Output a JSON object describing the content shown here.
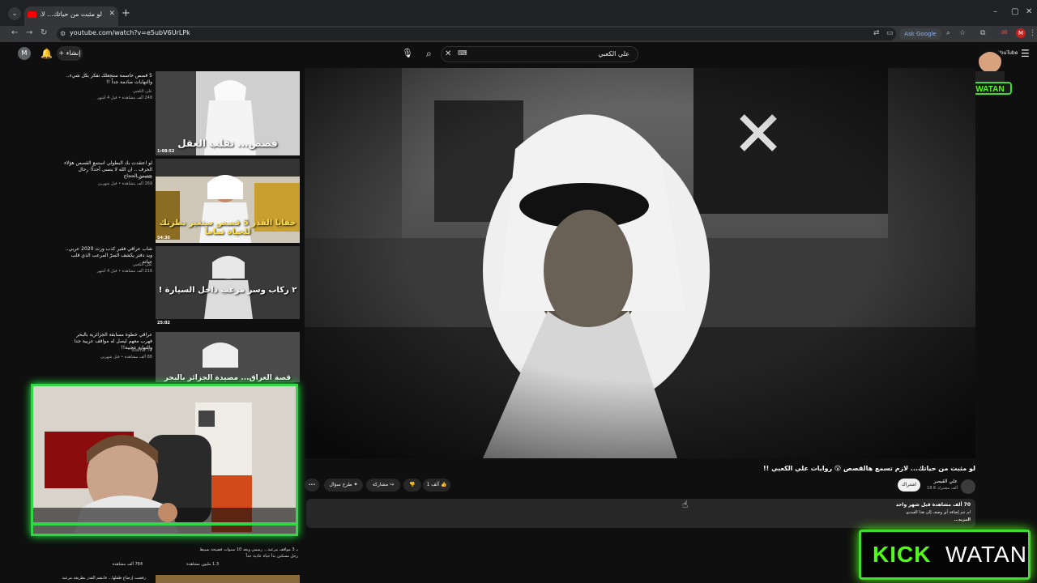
{
  "browser": {
    "tab_title": "لو مثبت من حياتك... لازم تسم",
    "url": "youtube.com/watch?v=e5ubV6UrLPk",
    "ask_google": "Ask Google",
    "profile_letter": "M"
  },
  "header": {
    "create_label": "إنشاء",
    "search_query": "علي الكعبي",
    "avatar_letter": "M",
    "yt_text": "YouTube",
    "overlay_logo": "WATAN"
  },
  "sidebar": [
    {
      "title": "5 قصص حاسمة ستجعلك تفكر بكل شيء.. والنهايات صادمة جداً !!",
      "channel": "علي الكعبي",
      "meta": "248 ألف مشاهدة • قبل 4 أشهر",
      "caption": "قصص... تقلب العقل",
      "duration": "1:08:52"
    },
    {
      "title": "لو اعتقدت بك البطولي استمع القصص هؤلاء الحرف .. ان الله لا ينسى أحداً! رحال جسس الحجاج",
      "channel": "ملاك داود",
      "meta": "269 ألف مشاهدة • قبل شهرين",
      "caption": "خفايا القدر 5 قصص ستغير نظرتك للحياة تماماً",
      "duration": "54:30"
    },
    {
      "title": "شاب عراقي فقير كذب ورث 2020 عربي.. ويد دفتر يكشف السرّ المرعب الذي قلب حياته",
      "channel": "علي الكعبي",
      "meta": "216 ألف مشاهدة • قبل 4 أشهر",
      "caption": "٢ ركاب وسر مرعب داخل السيارة !",
      "duration": "25:02"
    },
    {
      "title": "عراقي خطوة مسابقة الجزائرية بالبحر فهرب معهم ليصل له مواقف عربية جدا والنهاية عجيبة!!",
      "channel": "Islamic TV",
      "meta": "88 ألف مشاهدة • قبل شهرين",
      "caption": "قصة العراق... مصيدة الجزائر بالبحر",
      "duration": ""
    }
  ],
  "video": {
    "title": "لو مثبت من حياتك... لازم تسمع هالقصص 😮 روايات علي الكعبي !!",
    "channel": "علي القيصر",
    "subs": "18.6 ألف مشترك",
    "subscribe_label": "اشتراك",
    "likes": "1 ألف",
    "share": "مشاركة",
    "ask": "طرح سؤال",
    "more": "•••",
    "views": "70 ألف مشاهدة قبل شهر واحد",
    "desc_line": "لم تتم إضافة أي وصف إلى هذا الفيديو.",
    "desc_more": "المزيد..."
  },
  "lower_rows": [
    {
      "text": "بـ 3 مواقف مرعبة... رسمي وبعد 10 سنوات فضيحة بسيط",
      "meta": "764 ألف مشاهدة"
    },
    {
      "text": "رجل مسكين بدأ حياة عادية جداً",
      "meta": "1.3 مليون مشاهدة"
    },
    {
      "text": "رفضت إرضاع طفلها... فانتقم القدر بطريقة مرعبة",
      "meta": ""
    }
  ],
  "kick": {
    "kick": "KICK",
    "watan": "WATAN"
  }
}
